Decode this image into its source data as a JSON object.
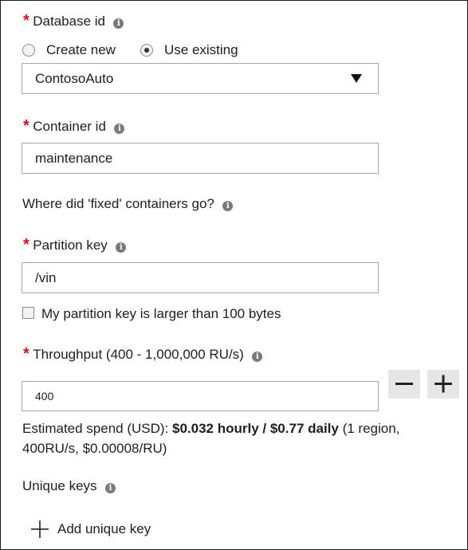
{
  "database": {
    "label": "Database id",
    "create_new_label": "Create new",
    "use_existing_label": "Use existing",
    "selected_option": "use_existing",
    "select_value": "ContosoAuto"
  },
  "container": {
    "label": "Container id",
    "value": "maintenance"
  },
  "fixed_link": "Where did 'fixed' containers go?",
  "partition": {
    "label": "Partition key",
    "value": "/vin",
    "large_key_label": "My partition key is larger than 100 bytes",
    "large_key_checked": false
  },
  "throughput": {
    "label": "Throughput (400 - 1,000,000 RU/s)",
    "value": "400",
    "estimate_prefix": "Estimated spend (USD): ",
    "estimate_bold": "$0.032 hourly / $0.77 daily",
    "estimate_suffix_line1": " (1 region,",
    "estimate_line2": "400RU/s, $0.00008/RU)"
  },
  "unique_keys": {
    "label": "Unique keys",
    "add_label": "Add unique key"
  },
  "required_marker": "*",
  "info_glyph": "i",
  "colors": {
    "required": "#e00b1c",
    "border": "#a6a6a6",
    "button_bg": "#e6e6e6"
  }
}
